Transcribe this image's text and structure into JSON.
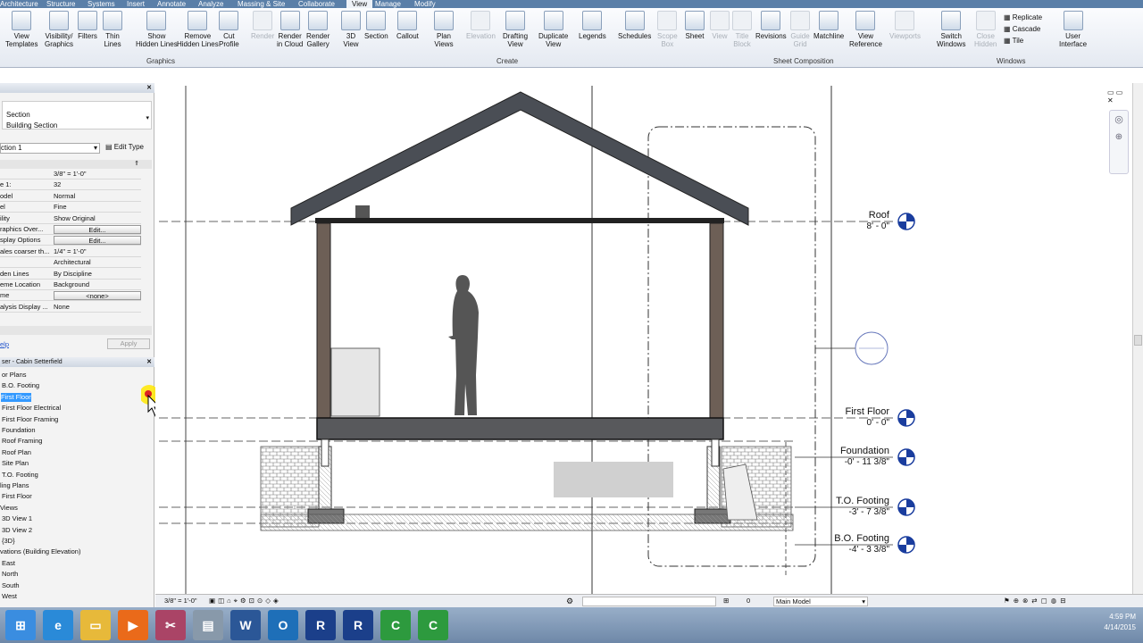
{
  "ribbon_tabs": [
    "Architecture",
    "Structure",
    "Systems",
    "Insert",
    "Annotate",
    "Analyze",
    "Massing & Site",
    "Collaborate",
    "View",
    "Manage",
    "Modify"
  ],
  "active_tab": "View",
  "ribbon": {
    "graphics": [
      "View\nTemplates",
      "Visibility/\nGraphics",
      "Filters",
      "Thin\nLines",
      "Show\nHidden Lines",
      "Remove\nHidden Lines",
      "Cut\nProfile"
    ],
    "presentation": [
      "Render",
      "Render\nin Cloud",
      "Render\nGallery"
    ],
    "create": [
      "3D\nView",
      "Section",
      "Callout",
      "Plan\nViews",
      "Elevation",
      "Drafting\nView",
      "Duplicate\nView",
      "Legends",
      "Schedules",
      "Scope\nBox"
    ],
    "sheet": [
      "Sheet",
      "View",
      "Title\nBlock",
      "Revisions",
      "Guide\nGrid",
      "Matchline",
      "View\nReference",
      "Viewports"
    ],
    "windows": [
      "Switch\nWindows",
      "Close\nHidden"
    ],
    "windows_small": [
      "Replicate",
      "Cascade",
      "Tile"
    ],
    "ui": "User\nInterface",
    "panel_labels": {
      "graphics": "Graphics",
      "create": "Create",
      "sheet": "Sheet Composition",
      "windows": "Windows"
    }
  },
  "properties": {
    "type_line1": "Section",
    "type_line2": "Building Section",
    "instance": "ction 1",
    "edit_type": "Edit Type",
    "rows": [
      {
        "k": "",
        "v": "3/8\" = 1'-0\"",
        "btn": false
      },
      {
        "k": "e   1:",
        "v": "32",
        "btn": false
      },
      {
        "k": "odel",
        "v": "Normal",
        "btn": false
      },
      {
        "k": "el",
        "v": "Fine",
        "btn": false
      },
      {
        "k": "ility",
        "v": "Show Original",
        "btn": false
      },
      {
        "k": "raphics Over...",
        "v": "Edit...",
        "btn": true
      },
      {
        "k": "splay Options",
        "v": "Edit...",
        "btn": true
      },
      {
        "k": "ales coarser th...",
        "v": "1/4\" = 1'-0\"",
        "btn": false
      },
      {
        "k": "",
        "v": "Architectural",
        "btn": false
      },
      {
        "k": "den Lines",
        "v": "By Discipline",
        "btn": false
      },
      {
        "k": "eme Location",
        "v": "Background",
        "btn": false
      },
      {
        "k": "me",
        "v": "<none>",
        "btn": true
      },
      {
        "k": "alysis Display ...",
        "v": "None",
        "btn": false
      }
    ],
    "help": "elp",
    "apply": "Apply"
  },
  "browser": {
    "title": "ser - Cabin Setterfield",
    "items": [
      {
        "label": "or Plans",
        "x": 2,
        "sel": false
      },
      {
        "label": "B.O. Footing",
        "x": 2,
        "sel": false
      },
      {
        "label": "First Floor",
        "x": 1,
        "sel": true
      },
      {
        "label": "First Floor Electrical",
        "x": 2,
        "sel": false
      },
      {
        "label": "First Floor Framing",
        "x": 2,
        "sel": false
      },
      {
        "label": "Foundation",
        "x": 2,
        "sel": false
      },
      {
        "label": "Roof Framing",
        "x": 2,
        "sel": false
      },
      {
        "label": "Roof Plan",
        "x": 2,
        "sel": false
      },
      {
        "label": "Site Plan",
        "x": 2,
        "sel": false
      },
      {
        "label": "T.O. Footing",
        "x": 2,
        "sel": false
      },
      {
        "label": "ling Plans",
        "x": 0,
        "sel": false
      },
      {
        "label": "First Floor",
        "x": 2,
        "sel": false
      },
      {
        "label": "Views",
        "x": 0,
        "sel": false
      },
      {
        "label": "3D View 1",
        "x": 2,
        "sel": false
      },
      {
        "label": "3D View 2",
        "x": 2,
        "sel": false
      },
      {
        "label": "{3D}",
        "x": 2,
        "sel": false
      },
      {
        "label": "vations (Building Elevation)",
        "x": 0,
        "sel": false
      },
      {
        "label": "East",
        "x": 2,
        "sel": false
      },
      {
        "label": "North",
        "x": 2,
        "sel": false
      },
      {
        "label": "South",
        "x": 2,
        "sel": false
      },
      {
        "label": "West",
        "x": 2,
        "sel": false
      }
    ]
  },
  "levels": [
    {
      "name": "Roof",
      "elev": "8' - 0\""
    },
    {
      "name": "First Floor",
      "elev": "0' - 0\""
    },
    {
      "name": "Foundation",
      "elev": "-0' - 11 3/8\""
    },
    {
      "name": "T.O. Footing",
      "elev": "-3' - 7 3/8\""
    },
    {
      "name": "B.O. Footing",
      "elev": "-4' - 3 3/8\""
    }
  ],
  "view_scale": "3/8\" = 1'-0\"",
  "status": {
    "workset_value": "0",
    "model": "Main Model"
  },
  "clock": {
    "time": "4:59 PM",
    "date": "4/14/2015"
  },
  "taskbar_apps": [
    "start",
    "ie",
    "explorer",
    "media",
    "snip",
    "notes",
    "word",
    "outlook",
    "revit1",
    "revit2",
    "camtasia1",
    "camtasia2"
  ]
}
